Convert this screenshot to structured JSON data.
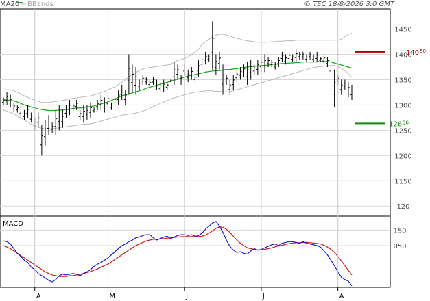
{
  "header": {
    "ma_label": "MA20",
    "bbands_label": "BBands",
    "copyright": "© TEC 18/8/2026 3:0 GMT"
  },
  "macd": {
    "label": "MACD"
  },
  "colors": {
    "ma": "#22aa22",
    "bands": "#b8b8b8",
    "price": "#000000",
    "resistance": "#aa0000",
    "support": "#118811",
    "macd_line": "#1a1ad0",
    "signal_line": "#d01a1a",
    "grid": "#d8d8d8"
  },
  "chart_data": [
    {
      "type": "ohlc",
      "x_labels": [
        {
          "label": "A",
          "index": 9
        },
        {
          "label": "M",
          "index": 30
        },
        {
          "label": "J",
          "index": 52
        },
        {
          "label": "J",
          "index": 74
        },
        {
          "label": "A",
          "index": 96
        }
      ],
      "yticks": [
        "120",
        "1150",
        "1200",
        "1250",
        "1300",
        "1350",
        "1400",
        "1450"
      ],
      "yticks_values": [
        1100,
        1150,
        1200,
        1250,
        1300,
        1350,
        1400,
        1450
      ],
      "ylim": [
        1080,
        1490
      ],
      "lines": [
        {
          "name": "resistance",
          "label_int": "140",
          "label_dec": "50",
          "value": 1405
        },
        {
          "name": "support",
          "label_int": "126",
          "label_dec": "36",
          "value": 1263.6
        }
      ],
      "price": [
        [
          1315,
          1300
        ],
        [
          1325,
          1300
        ],
        [
          1320,
          1295
        ],
        [
          1305,
          1285
        ],
        [
          1300,
          1285
        ],
        [
          1310,
          1270
        ],
        [
          1290,
          1270
        ],
        [
          1300,
          1275
        ],
        [
          1285,
          1265
        ],
        [
          1275,
          1250
        ],
        [
          1285,
          1255
        ],
        [
          1260,
          1200
        ],
        [
          1270,
          1220
        ],
        [
          1280,
          1240
        ],
        [
          1265,
          1245
        ],
        [
          1290,
          1240
        ],
        [
          1300,
          1250
        ],
        [
          1290,
          1255
        ],
        [
          1300,
          1275
        ],
        [
          1310,
          1280
        ],
        [
          1305,
          1285
        ],
        [
          1310,
          1290
        ],
        [
          1290,
          1270
        ],
        [
          1300,
          1265
        ],
        [
          1300,
          1270
        ],
        [
          1305,
          1275
        ],
        [
          1295,
          1285
        ],
        [
          1310,
          1290
        ],
        [
          1320,
          1290
        ],
        [
          1315,
          1285
        ],
        [
          1325,
          1290
        ],
        [
          1305,
          1290
        ],
        [
          1320,
          1295
        ],
        [
          1330,
          1300
        ],
        [
          1340,
          1310
        ],
        [
          1330,
          1300
        ],
        [
          1400,
          1320
        ],
        [
          1380,
          1325
        ],
        [
          1375,
          1320
        ],
        [
          1350,
          1330
        ],
        [
          1360,
          1340
        ],
        [
          1355,
          1340
        ],
        [
          1350,
          1335
        ],
        [
          1355,
          1340
        ],
        [
          1350,
          1330
        ],
        [
          1345,
          1325
        ],
        [
          1350,
          1325
        ],
        [
          1345,
          1330
        ],
        [
          1350,
          1345
        ],
        [
          1385,
          1340
        ],
        [
          1380,
          1350
        ],
        [
          1360,
          1340
        ],
        [
          1380,
          1360
        ],
        [
          1370,
          1345
        ],
        [
          1375,
          1350
        ],
        [
          1360,
          1345
        ],
        [
          1390,
          1355
        ],
        [
          1400,
          1370
        ],
        [
          1405,
          1380
        ],
        [
          1400,
          1385
        ],
        [
          1465,
          1370
        ],
        [
          1400,
          1360
        ],
        [
          1405,
          1370
        ],
        [
          1380,
          1320
        ],
        [
          1360,
          1340
        ],
        [
          1350,
          1320
        ],
        [
          1360,
          1330
        ],
        [
          1370,
          1345
        ],
        [
          1375,
          1350
        ],
        [
          1380,
          1355
        ],
        [
          1385,
          1340
        ],
        [
          1390,
          1350
        ],
        [
          1380,
          1360
        ],
        [
          1390,
          1360
        ],
        [
          1395,
          1365
        ],
        [
          1400,
          1365
        ],
        [
          1395,
          1375
        ],
        [
          1390,
          1375
        ],
        [
          1385,
          1370
        ],
        [
          1395,
          1375
        ],
        [
          1405,
          1385
        ],
        [
          1400,
          1380
        ],
        [
          1405,
          1385
        ],
        [
          1400,
          1385
        ],
        [
          1410,
          1385
        ],
        [
          1405,
          1390
        ],
        [
          1405,
          1390
        ],
        [
          1400,
          1385
        ],
        [
          1405,
          1390
        ],
        [
          1400,
          1385
        ],
        [
          1405,
          1385
        ],
        [
          1395,
          1385
        ],
        [
          1400,
          1380
        ],
        [
          1395,
          1375
        ],
        [
          1380,
          1360
        ],
        [
          1370,
          1295
        ],
        [
          1360,
          1340
        ],
        [
          1350,
          1320
        ],
        [
          1350,
          1330
        ],
        [
          1345,
          1315
        ],
        [
          1340,
          1310
        ]
      ],
      "ma20": [
        1310,
        1310,
        1309,
        1308,
        1306,
        1303,
        1300,
        1298,
        1296,
        1294,
        1292,
        1291,
        1290,
        1289,
        1289,
        1289,
        1290,
        1290,
        1291,
        1292,
        1293,
        1294,
        1294,
        1295,
        1296,
        1297,
        1298,
        1300,
        1302,
        1304,
        1306,
        1309,
        1312,
        1315,
        1318,
        1320,
        1322,
        1324,
        1326,
        1328,
        1330,
        1333,
        1335,
        1337,
        1339,
        1341,
        1343,
        1345,
        1347,
        1349,
        1351,
        1353,
        1355,
        1357,
        1359,
        1360,
        1362,
        1363,
        1365,
        1366,
        1367,
        1368,
        1368,
        1369,
        1370,
        1370,
        1371,
        1372,
        1373,
        1374,
        1375,
        1376,
        1376,
        1377,
        1378,
        1378,
        1379,
        1380,
        1381,
        1381,
        1382,
        1382,
        1383,
        1383,
        1384,
        1384,
        1385,
        1385,
        1385,
        1385,
        1385,
        1386,
        1386,
        1386,
        1385,
        1383,
        1381,
        1379,
        1377,
        1375,
        1373
      ],
      "bb_upper": [
        1330,
        1330,
        1330,
        1328,
        1325,
        1322,
        1318,
        1315,
        1312,
        1309,
        1307,
        1305,
        1305,
        1305,
        1306,
        1307,
        1308,
        1309,
        1310,
        1312,
        1313,
        1314,
        1315,
        1316,
        1317,
        1318,
        1320,
        1322,
        1324,
        1327,
        1330,
        1333,
        1336,
        1340,
        1345,
        1350,
        1356,
        1360,
        1364,
        1368,
        1371,
        1373,
        1374,
        1375,
        1376,
        1377,
        1378,
        1379,
        1380,
        1385,
        1388,
        1390,
        1392,
        1395,
        1400,
        1405,
        1410,
        1420,
        1425,
        1430,
        1435,
        1438,
        1440,
        1440,
        1438,
        1436,
        1434,
        1432,
        1430,
        1428,
        1427,
        1426,
        1425,
        1424,
        1424,
        1424,
        1424,
        1425,
        1425,
        1426,
        1426,
        1427,
        1427,
        1427,
        1428,
        1428,
        1428,
        1428,
        1428,
        1428,
        1428,
        1428,
        1428,
        1428,
        1428,
        1428,
        1428,
        1430,
        1435,
        1440,
        1442
      ],
      "bb_lower": [
        1290,
        1288,
        1285,
        1282,
        1278,
        1274,
        1270,
        1266,
        1262,
        1259,
        1256,
        1254,
        1253,
        1253,
        1253,
        1254,
        1255,
        1256,
        1257,
        1258,
        1259,
        1260,
        1261,
        1262,
        1262,
        1263,
        1264,
        1266,
        1268,
        1270,
        1272,
        1274,
        1276,
        1278,
        1280,
        1281,
        1282,
        1283,
        1284,
        1286,
        1288,
        1290,
        1293,
        1297,
        1300,
        1303,
        1306,
        1309,
        1312,
        1314,
        1316,
        1318,
        1320,
        1322,
        1324,
        1325,
        1326,
        1327,
        1328,
        1328,
        1328,
        1327,
        1327,
        1326,
        1326,
        1326,
        1328,
        1330,
        1332,
        1334,
        1336,
        1338,
        1340,
        1342,
        1344,
        1346,
        1348,
        1350,
        1352,
        1354,
        1356,
        1358,
        1360,
        1362,
        1364,
        1366,
        1368,
        1370,
        1372,
        1374,
        1375,
        1376,
        1377,
        1378,
        1378,
        1378,
        1376,
        1373,
        1368,
        1362,
        1355
      ]
    },
    {
      "type": "line",
      "name": "MACD",
      "yticks": [
        "150",
        "050"
      ],
      "yticks_values": [
        1.5,
        0.5
      ],
      "ylim": [
        -2.2,
        2.4
      ],
      "macd": [
        0.8,
        0.75,
        0.6,
        0.3,
        0.0,
        -0.2,
        -0.45,
        -0.6,
        -0.9,
        -1.05,
        -1.3,
        -1.45,
        -1.6,
        -1.75,
        -1.85,
        -1.7,
        -1.45,
        -1.35,
        -1.4,
        -1.35,
        -1.3,
        -1.35,
        -1.45,
        -1.3,
        -1.2,
        -1.05,
        -0.85,
        -0.7,
        -0.6,
        -0.45,
        -0.3,
        -0.1,
        0.1,
        0.3,
        0.5,
        0.6,
        0.75,
        0.85,
        1.0,
        1.05,
        1.15,
        1.2,
        1.2,
        1.0,
        0.85,
        0.95,
        1.05,
        1.1,
        0.95,
        1.05,
        1.15,
        1.2,
        1.2,
        1.15,
        1.2,
        1.1,
        1.15,
        1.3,
        1.55,
        1.75,
        1.95,
        2.05,
        1.75,
        1.35,
        0.85,
        0.45,
        0.2,
        0.05,
        0.1,
        0.0,
        -0.05,
        0.15,
        0.3,
        0.2,
        0.25,
        0.35,
        0.45,
        0.55,
        0.6,
        0.5,
        0.65,
        0.7,
        0.75,
        0.75,
        0.7,
        0.65,
        0.75,
        0.65,
        0.6,
        0.55,
        0.5,
        0.4,
        0.15,
        -0.1,
        -0.45,
        -0.8,
        -1.2,
        -1.55,
        -1.7,
        -1.8,
        -2.1
      ],
      "signal": [
        0.5,
        0.4,
        0.3,
        0.15,
        0.0,
        -0.15,
        -0.3,
        -0.45,
        -0.6,
        -0.75,
        -0.9,
        -1.05,
        -1.2,
        -1.3,
        -1.4,
        -1.45,
        -1.5,
        -1.5,
        -1.5,
        -1.45,
        -1.45,
        -1.4,
        -1.35,
        -1.3,
        -1.25,
        -1.18,
        -1.1,
        -1.0,
        -0.9,
        -0.8,
        -0.7,
        -0.55,
        -0.4,
        -0.25,
        -0.1,
        0.05,
        0.2,
        0.35,
        0.5,
        0.6,
        0.7,
        0.8,
        0.85,
        0.9,
        0.9,
        0.92,
        0.95,
        0.98,
        1.0,
        1.02,
        1.05,
        1.07,
        1.08,
        1.08,
        1.08,
        1.07,
        1.08,
        1.1,
        1.18,
        1.3,
        1.45,
        1.6,
        1.7,
        1.68,
        1.55,
        1.35,
        1.1,
        0.85,
        0.65,
        0.5,
        0.35,
        0.3,
        0.25,
        0.22,
        0.22,
        0.25,
        0.3,
        0.35,
        0.42,
        0.48,
        0.52,
        0.58,
        0.62,
        0.66,
        0.68,
        0.68,
        0.7,
        0.7,
        0.68,
        0.66,
        0.63,
        0.6,
        0.52,
        0.4,
        0.25,
        0.05,
        -0.2,
        -0.5,
        -0.8,
        -1.1,
        -1.4
      ]
    }
  ]
}
